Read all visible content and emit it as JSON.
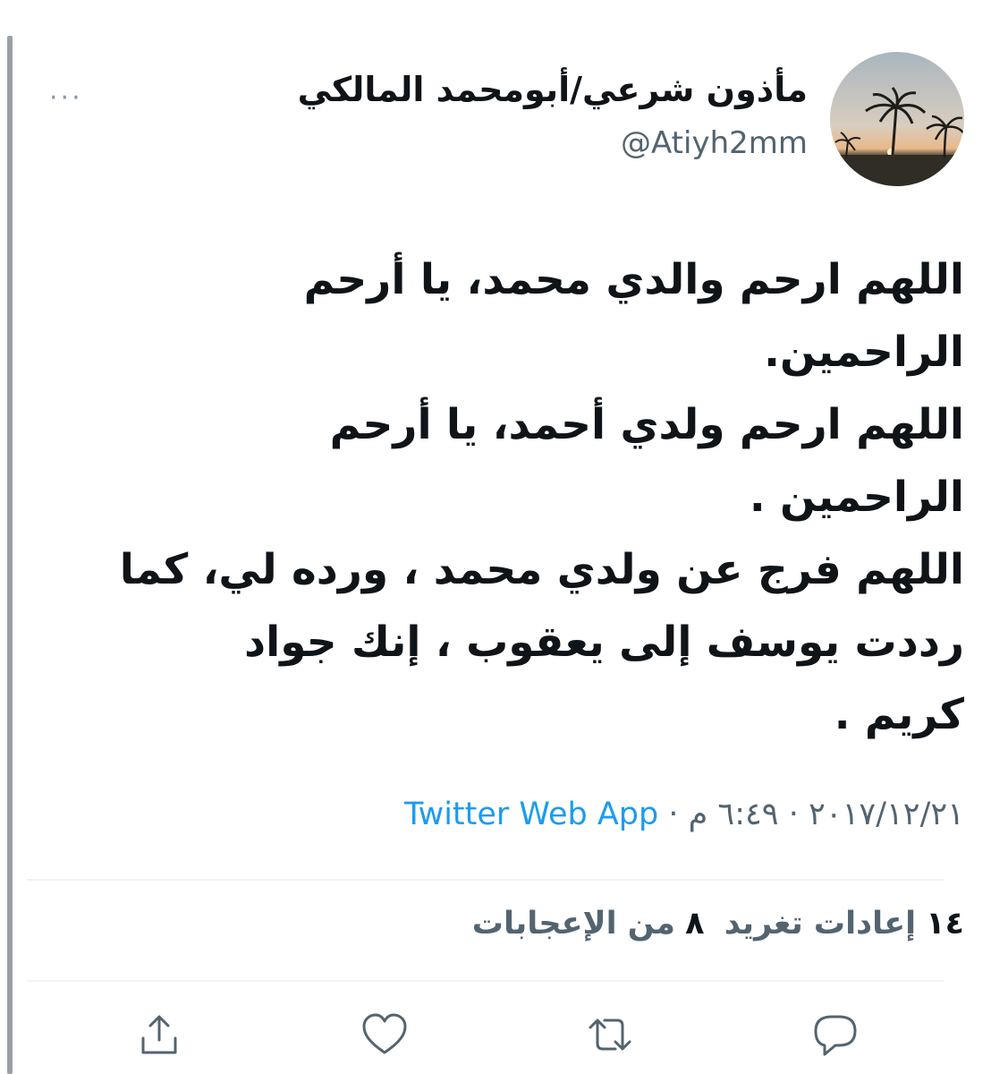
{
  "tweet": {
    "author": {
      "display_name": "مأذون شرعي/أبومحمد المالكي",
      "handle": "@Atiyh2mm"
    },
    "more_label": "···",
    "body_lines": [
      "اللهم ارحم والدي محمد، يا أرحم",
      "الراحمين.",
      "اللهم ارحم ولدي أحمد، يا أرحم",
      "الراحمين .",
      "اللهم فرج عن ولدي محمد ، ورده لي، كما",
      "رددت يوسف إلى يعقوب ، إنك جواد",
      "كريم ."
    ],
    "date": "٢٠١٧/١٢/٢١",
    "separator": " · ",
    "time": "٦:٤٩ م",
    "source": "Twitter Web App",
    "retweets_count": "١٤",
    "retweets_label": "إعادات تغريد",
    "likes_count": "٨",
    "likes_label": "من الإعجابات"
  },
  "icons": {
    "more": "more-dots-icon",
    "share": "share-icon",
    "like": "heart-icon",
    "retweet": "retweet-icon",
    "reply": "reply-icon"
  },
  "colors": {
    "link": "#1d9bf0",
    "secondary_text": "#536471",
    "primary_text": "#0f1419",
    "divider": "#eff3f4"
  }
}
